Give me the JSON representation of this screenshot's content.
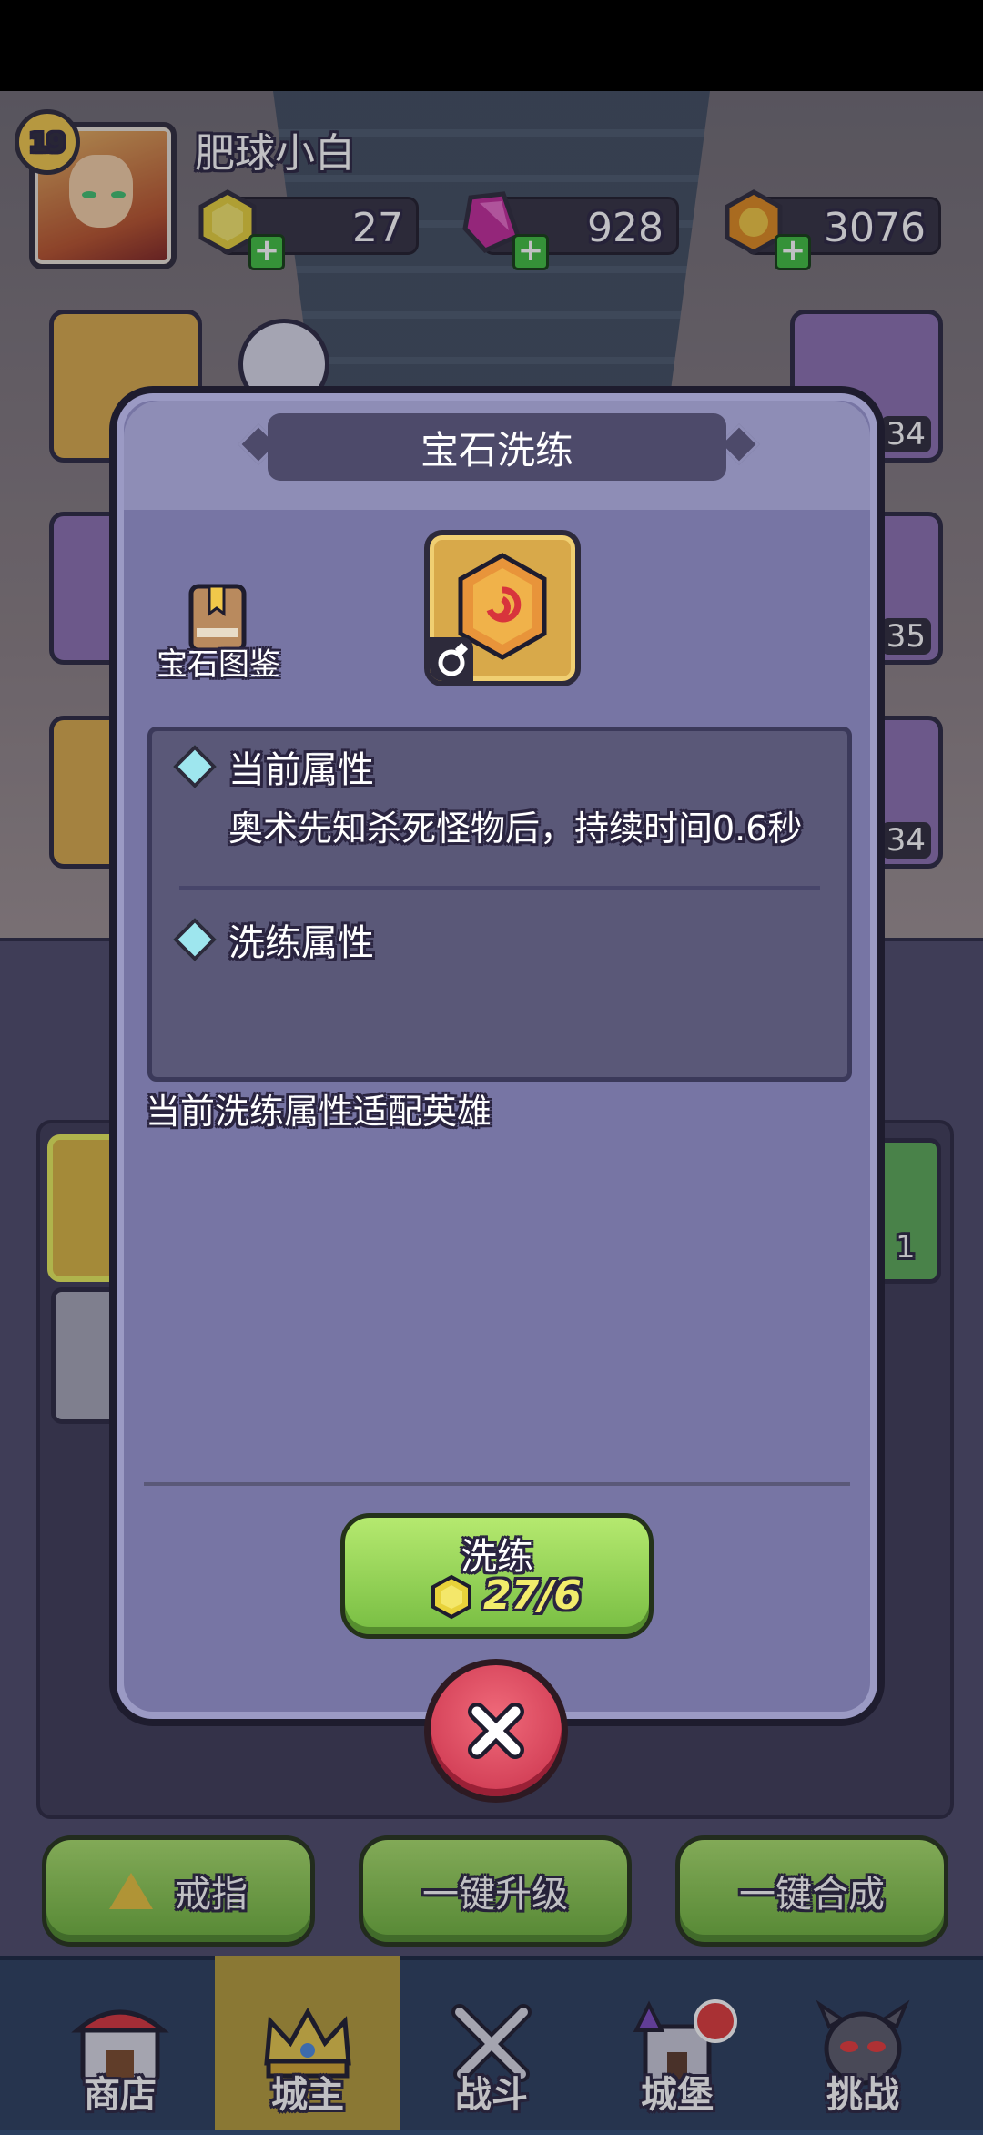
{
  "player": {
    "name": "肥球小白",
    "level": "19"
  },
  "currencies": [
    {
      "icon": "gold-gem-icon",
      "value": "27"
    },
    {
      "icon": "pink-crystal-icon",
      "value": "928"
    },
    {
      "icon": "coin-icon",
      "value": "3076"
    }
  ],
  "side_slots": {
    "r1": "34",
    "r2": "35",
    "r3": "34"
  },
  "inventory": {
    "green_count": "1"
  },
  "dialog": {
    "title": "宝石洗练",
    "codex_label": "宝石图鉴",
    "current_attr_title": "当前属性",
    "current_attr_desc": "奥术先知杀死怪物后，持续时间0.6秒",
    "reroll_attr_title": "洗练属性",
    "hero_note": "当前洗练属性适配英雄",
    "reroll_button": "洗练",
    "reroll_cost": "27/6"
  },
  "actions": {
    "ring": "戒指",
    "upgrade": "一键升级",
    "merge": "一键合成"
  },
  "nav": {
    "shop": "商店",
    "lord": "城主",
    "battle": "战斗",
    "castle": "城堡",
    "challenge": "挑战"
  },
  "colors": {
    "dialog_bg": "#7775a4",
    "button_green": "#77bd42",
    "close_red": "#c8304a",
    "nav_active": "#b59b3a"
  }
}
